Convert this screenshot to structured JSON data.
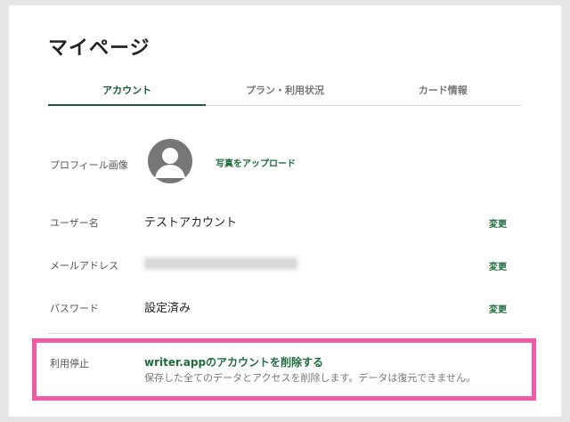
{
  "page": {
    "title": "マイページ"
  },
  "tabs": [
    {
      "label": "アカウント",
      "active": true
    },
    {
      "label": "プラン・利用状況",
      "active": false
    },
    {
      "label": "カード情報",
      "active": false
    }
  ],
  "profile": {
    "label": "プロフィール画像",
    "upload_label": "写真をアップロード"
  },
  "username": {
    "label": "ユーザー名",
    "value": "テストアカウント",
    "change_label": "変更"
  },
  "email": {
    "label": "メールアドレス",
    "change_label": "変更"
  },
  "password": {
    "label": "パスワード",
    "value": "設定済み",
    "change_label": "変更"
  },
  "deactivate": {
    "label": "利用停止",
    "link": "writer.appのアカウントを削除する",
    "description": "保存した全てのデータとアクセスを削除します。データは復元できません。"
  },
  "colors": {
    "accent": "#1f6b3f",
    "highlight": "#f05aa6",
    "avatar": "#777777"
  }
}
